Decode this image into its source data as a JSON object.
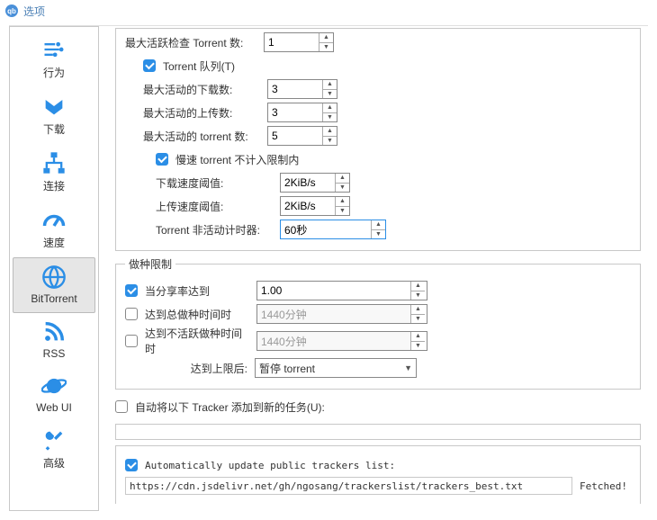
{
  "window": {
    "title": "选项",
    "icon_label": "qb"
  },
  "sidebar": {
    "items": [
      {
        "label": "行为"
      },
      {
        "label": "下载"
      },
      {
        "label": "连接"
      },
      {
        "label": "速度"
      },
      {
        "label": "BitTorrent"
      },
      {
        "label": "RSS"
      },
      {
        "label": "Web UI"
      },
      {
        "label": "高级"
      }
    ]
  },
  "top_fieldset_legend_prefix": "最大活跃检查 Torrent 数:",
  "top_check_value": "1",
  "queue": {
    "checkbox_label": "Torrent 队列(T)",
    "max_active_downloads_label": "最大活动的下载数:",
    "max_active_downloads": "3",
    "max_active_uploads_label": "最大活动的上传数:",
    "max_active_uploads": "3",
    "max_active_torrents_label": "最大活动的 torrent 数:",
    "max_active_torrents": "5",
    "slow_exclude_label": "慢速 torrent 不计入限制内",
    "dl_threshold_label": "下载速度阈值:",
    "dl_threshold": "2KiB/s",
    "ul_threshold_label": "上传速度阈值:",
    "ul_threshold": "2KiB/s",
    "inactivity_label": "Torrent 非活动计时器:",
    "inactivity_value": "60秒"
  },
  "seeding": {
    "legend": "做种限制",
    "ratio_label": "当分享率达到",
    "ratio_value": "1.00",
    "seed_time_label": "达到总做种时间时",
    "seed_time_value": "1440分钟",
    "inactive_time_label": "达到不活跃做种时间时",
    "inactive_time_value": "1440分钟",
    "then_label": "达到上限后:",
    "then_action": "暂停 torrent"
  },
  "auto_add_tracker_label": "自动将以下 Tracker 添加到新的任务(U):",
  "auto_update": {
    "label": "Automatically update public trackers list:",
    "url": "https://cdn.jsdelivr.net/gh/ngosang/trackerslist/trackers_best.txt",
    "status": "Fetched!"
  }
}
